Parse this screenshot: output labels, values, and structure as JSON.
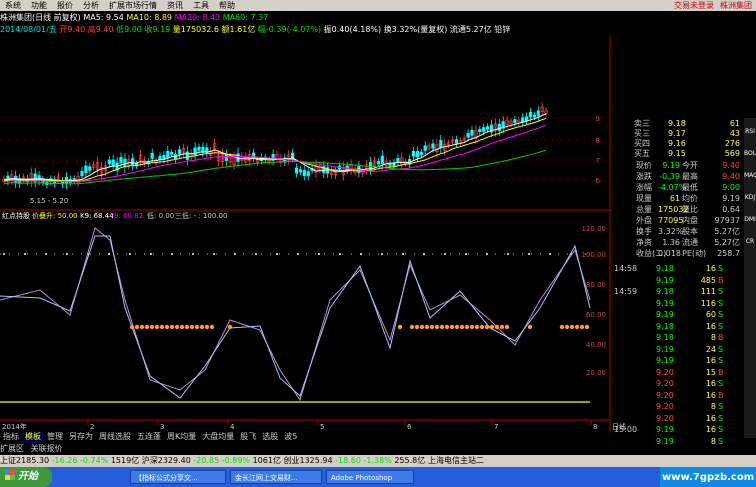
{
  "menu": {
    "items": [
      "系统",
      "功能",
      "报价",
      "分析",
      "扩展市场行情",
      "资讯",
      "工具",
      "帮助"
    ],
    "right": [
      "交易未登录",
      "株洲集团"
    ]
  },
  "chart_header": {
    "stock": "株洲集团(日线 前复权)",
    "ma5": "MA5: 9.54",
    "ma10": "MA10: 8.89",
    "ma20": "MA20: 8.43",
    "ma60": "MA60: 7.37"
  },
  "day_info": {
    "date": "2014/08/01/五",
    "open": "开9.40",
    "high": "高9.40",
    "low": "低9.00",
    "close": "收9.19",
    "vol": "量175032.6",
    "amount": "额1.61亿",
    "chg": "幅-0.39(-4.07%)",
    "amp": "振0.40(4.18%)",
    "turn": "换3.32%(量复权)",
    "flow": "流通5.27亿",
    "extra": "铅锌"
  },
  "price_axis": [
    "9",
    "8",
    "7",
    "6"
  ],
  "low_marker": "5.15 - 5.20",
  "indicator_header": {
    "name": "红点持股",
    "p1": "价叠升: 50.00",
    "p2": "K9: 68.44",
    "p3": "J9: 60.82",
    "p4": "低: 0.00",
    "p5": "三低: - : 100.00"
  },
  "indicator_axis": [
    "120.00",
    "100.00",
    "80.00",
    "60.00",
    "40.00",
    "20.00"
  ],
  "date_axis": {
    "label": "2014年",
    "months": [
      "2",
      "3",
      "4",
      "5",
      "6",
      "7",
      "8"
    ],
    "end": "日线"
  },
  "quote": {
    "asks": [
      {
        "label": "卖三",
        "price": "9.18",
        "qty": "61"
      },
      {
        "label": "买三",
        "price": "9.17",
        "qty": "43"
      },
      {
        "label": "买四",
        "price": "9.16",
        "qty": "276"
      },
      {
        "label": "买五",
        "price": "9.15",
        "qty": "569"
      }
    ],
    "stats": [
      {
        "l1": "现价",
        "v1": "9.19",
        "l2": "今开",
        "v2": "9.40"
      },
      {
        "l1": "涨跌",
        "v1": "-0.39",
        "l2": "最高",
        "v2": "9.40"
      },
      {
        "l1": "涨幅",
        "v1": "-4.07%",
        "l2": "最低",
        "v2": "9.00"
      },
      {
        "l1": "现量",
        "v1": "61",
        "l2": "均价",
        "v2": "9.19"
      },
      {
        "l1": "总量",
        "v1": "175032",
        "l2": "量比",
        "v2": "0.64"
      },
      {
        "l1": "外盘",
        "v1": "77095",
        "l2": "内盘",
        "v2": "97937"
      },
      {
        "l1": "换手",
        "v1": "3.32%",
        "l2": "股本",
        "v2": "5.27亿"
      },
      {
        "l1": "净资",
        "v1": "1.36",
        "l2": "流通",
        "v2": "5.27亿"
      },
      {
        "l1": "收益(二)",
        "v1": "0.018",
        "l2": "PE(动)",
        "v2": "258.7"
      }
    ],
    "ticks": [
      {
        "t": "14:58",
        "p": "9.18",
        "v": "16",
        "s": "S"
      },
      {
        "t": "",
        "p": "9.19",
        "v": "485",
        "s": "B"
      },
      {
        "t": "14:59",
        "p": "9.18",
        "v": "111",
        "s": "S"
      },
      {
        "t": "",
        "p": "9.19",
        "v": "116",
        "s": "S"
      },
      {
        "t": "",
        "p": "9.19",
        "v": "60",
        "s": "S"
      },
      {
        "t": "",
        "p": "9.18",
        "v": "16",
        "s": "S"
      },
      {
        "t": "",
        "p": "9.18",
        "v": "8",
        "s": "B"
      },
      {
        "t": "",
        "p": "9.19",
        "v": "24",
        "s": "S"
      },
      {
        "t": "",
        "p": "9.19",
        "v": "16",
        "s": "S"
      },
      {
        "t": "",
        "p": "9.20",
        "v": "15",
        "s": "B"
      },
      {
        "t": "",
        "p": "9.20",
        "v": "16",
        "s": "S"
      },
      {
        "t": "",
        "p": "9.20",
        "v": "16",
        "s": "B"
      },
      {
        "t": "",
        "p": "9.20",
        "v": "8",
        "s": "S"
      },
      {
        "t": "",
        "p": "9.20",
        "v": "16",
        "s": "S"
      },
      {
        "t": "15:00",
        "p": "9.19",
        "v": "16",
        "s": "S"
      },
      {
        "t": "",
        "p": "9.19",
        "v": "8",
        "s": "S"
      }
    ]
  },
  "side_tabs": [
    "RSI",
    "BOLL",
    "MACD",
    "KDJ",
    "DMI",
    "CR"
  ],
  "bottom_tabs": [
    "指标",
    "模板",
    "管理",
    "另存为",
    "周线选股",
    "五连蓬",
    "周K均量",
    "大盘均量",
    "股飞",
    "选股",
    "波5"
  ],
  "sub_tabs": [
    "扩展区",
    "关联报价"
  ],
  "status": {
    "sh": "上证2185.30",
    "sh_chg": "-16.26",
    "sh_pct": "-0.74%",
    "sh_amt": "1519亿",
    "hs": "沪深2329.40",
    "hs_chg": "-20.85",
    "hs_pct": "-0.89%",
    "hs_amt": "1061亿",
    "cy": "创业1325.94",
    "cy_chg": "-18.60",
    "cy_pct": "-1.38%",
    "cy_amt": "255.8亿",
    "server": "上海电信主站二"
  },
  "taskbar": {
    "start": "开始",
    "items": [
      "【指标公式分享交...",
      "金长江网上交易财...",
      "Adobe Photoshop"
    ],
    "watermark": "www.7gpzb.com"
  }
}
